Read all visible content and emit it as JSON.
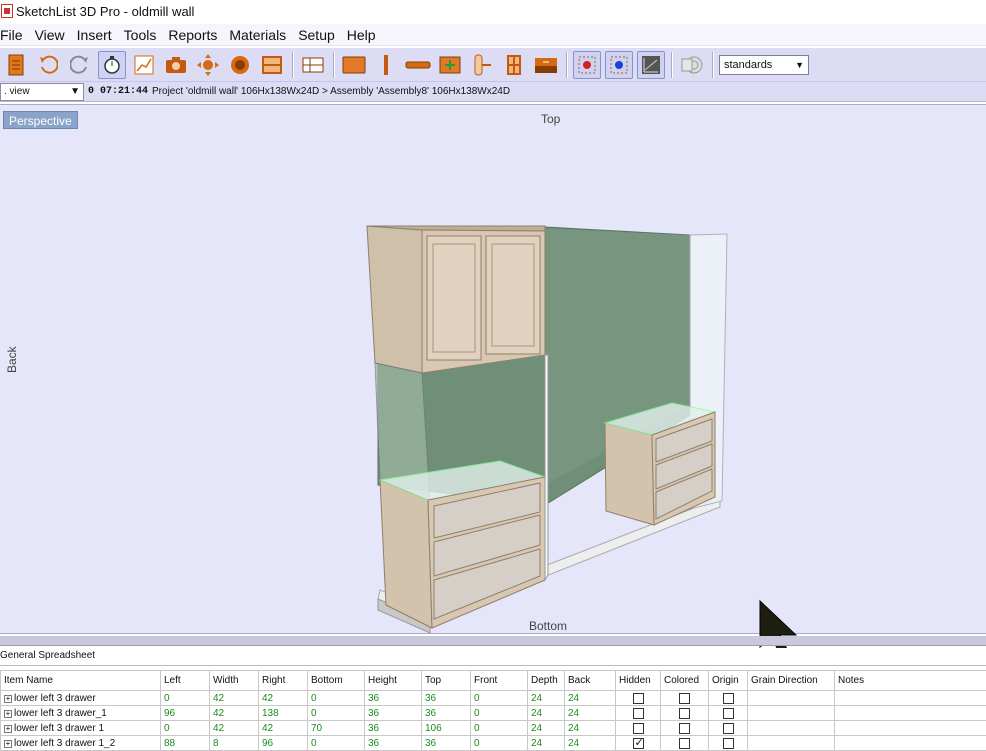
{
  "window": {
    "title": "SketchList 3D Pro - oldmill wall"
  },
  "menu": [
    "File",
    "View",
    "Insert",
    "Tools",
    "Reports",
    "Materials",
    "Setup",
    "Help"
  ],
  "toolbar": {
    "buttons": [
      "new-document-icon",
      "undo-icon",
      "redo-icon",
      "timer-icon",
      "chart-icon",
      "camera-icon",
      "arrows-icon",
      "circle-icon",
      "layout-icon",
      "panel-icon",
      "board-icon",
      "stick-icon",
      "thin-board-icon",
      "board-plus-icon",
      "hardware-icon",
      "door-icon",
      "drawer-icon",
      "select-red-icon",
      "select-blue-icon",
      "graph-icon",
      "roll-icon"
    ],
    "standards_value": "standards"
  },
  "infobar": {
    "view_select": ". view",
    "timer": "0 07:21:44",
    "path": "Project 'oldmill wall' 106Hx138Wx24D > Assembly 'Assembly8' 106Hx138Wx24D"
  },
  "viewport": {
    "tab": "Perspective",
    "label_top": "Top",
    "label_bottom": "Bottom",
    "label_back": "Back",
    "colors": {
      "wall": "#6f8f78",
      "wood": "#d6c4ae",
      "background": "#e6e6fa"
    }
  },
  "sheet": {
    "title": "General Spreadsheet",
    "columns": [
      "Item Name",
      "Left",
      "Width",
      "Right",
      "Bottom",
      "Height",
      "Top",
      "Front",
      "Depth",
      "Back",
      "Hidden",
      "Colored",
      "Origin",
      "Grain Direction",
      "Notes"
    ],
    "rows": [
      {
        "name": "lower left 3 drawer",
        "left": "0",
        "width": "42",
        "right": "42",
        "bottom": "0",
        "height": "36",
        "top": "36",
        "front": "0",
        "depth": "24",
        "back": "24",
        "hidden": false,
        "colored": false,
        "origin": false
      },
      {
        "name": "lower left 3 drawer_1",
        "left": "96",
        "width": "42",
        "right": "138",
        "bottom": "0",
        "height": "36",
        "top": "36",
        "front": "0",
        "depth": "24",
        "back": "24",
        "hidden": false,
        "colored": false,
        "origin": false
      },
      {
        "name": "lower left 3 drawer 1",
        "left": "0",
        "width": "42",
        "right": "42",
        "bottom": "70",
        "height": "36",
        "top": "106",
        "front": "0",
        "depth": "24",
        "back": "24",
        "hidden": false,
        "colored": false,
        "origin": false
      },
      {
        "name": "lower left 3 drawer 1_2",
        "left": "88",
        "width": "8",
        "right": "96",
        "bottom": "0",
        "height": "36",
        "top": "36",
        "front": "0",
        "depth": "24",
        "back": "24",
        "hidden": true,
        "colored": false,
        "origin": false
      }
    ]
  }
}
